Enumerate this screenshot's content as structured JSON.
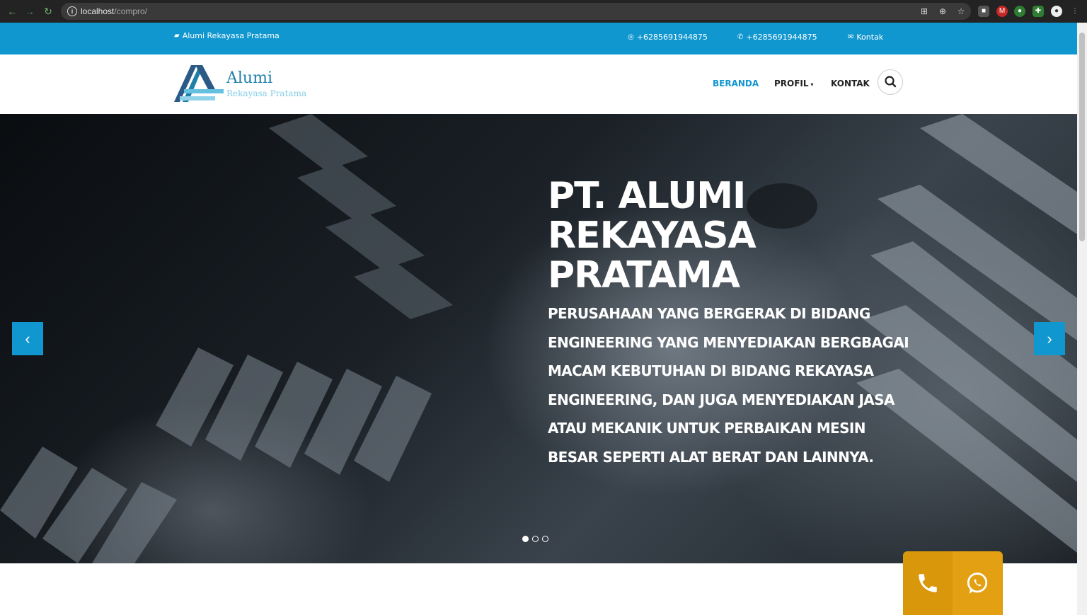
{
  "browser": {
    "url_host": "localhost",
    "url_path": "/compro/"
  },
  "topbar": {
    "brand": "Alumi Rekayasa Pratama",
    "whatsapp": "+6285691944875",
    "phone": "+6285691944875",
    "contact": "Kontak"
  },
  "logo": {
    "name": "Alumi",
    "subtitle": "Rekayasa Pratama"
  },
  "nav": {
    "home": "BERANDA",
    "profile": "PROFIL",
    "contact": "KONTAK"
  },
  "hero": {
    "title_line1": "PT. ALUMI",
    "title_line2": "REKAYASA",
    "title_line3": "PRATAMA",
    "description": "Perusahaan yang bergerak di bidang engineering yang menyediakan bergbagai macam kebutuhan di bidang rekayasa engineering, dan juga menyediakan jasa atau mekanik untuk perbaikan mesin besar seperti alat berat dan lainnya.",
    "prev": "‹",
    "next": "›",
    "slides_total": 3,
    "active_slide": 1
  },
  "colors": {
    "accent": "#1197cf",
    "float_button": "#d9980c"
  }
}
